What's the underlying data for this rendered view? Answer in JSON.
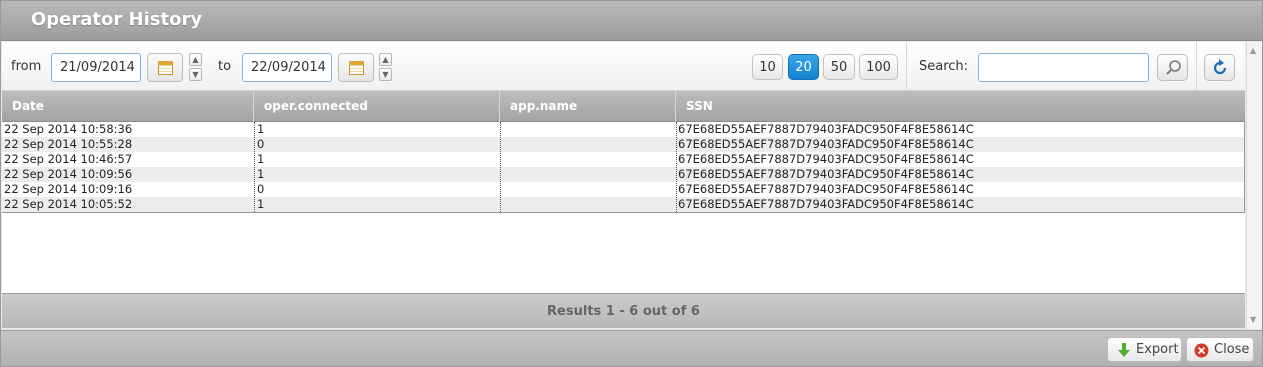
{
  "window": {
    "title": "Operator History"
  },
  "filters": {
    "from_label": "from",
    "from_value": "21/09/2014",
    "to_label": "to",
    "to_value": "22/09/2014"
  },
  "page_size": {
    "options": [
      "10",
      "20",
      "50",
      "100"
    ],
    "selected": "20"
  },
  "search": {
    "label": "Search:",
    "value": ""
  },
  "table": {
    "columns": [
      "Date",
      "oper.connected",
      "app.name",
      "SSN"
    ],
    "rows": [
      [
        "22 Sep 2014 10:58:36",
        "1",
        "",
        "67E68ED55AEF7887D79403FADC950F4F8E58614C"
      ],
      [
        "22 Sep 2014 10:55:28",
        "0",
        "",
        "67E68ED55AEF7887D79403FADC950F4F8E58614C"
      ],
      [
        "22 Sep 2014 10:46:57",
        "1",
        "",
        "67E68ED55AEF7887D79403FADC950F4F8E58614C"
      ],
      [
        "22 Sep 2014 10:09:56",
        "1",
        "",
        "67E68ED55AEF7887D79403FADC950F4F8E58614C"
      ],
      [
        "22 Sep 2014 10:09:16",
        "0",
        "",
        "67E68ED55AEF7887D79403FADC950F4F8E58614C"
      ],
      [
        "22 Sep 2014 10:05:52",
        "1",
        "",
        "67E68ED55AEF7887D79403FADC950F4F8E58614C"
      ]
    ]
  },
  "results": {
    "text": "Results 1 - 6 out of 6"
  },
  "footer": {
    "export_label": "Export",
    "close_label": "Close"
  },
  "icons": {
    "calendar": "calendar-icon",
    "search": "magnifier-icon",
    "refresh": "refresh-icon",
    "export": "down-arrow-icon",
    "close": "close-circle-icon"
  },
  "colors": {
    "accent": "#1a8ad8",
    "export_icon": "#4cae32",
    "close_icon": "#d23c2a"
  }
}
